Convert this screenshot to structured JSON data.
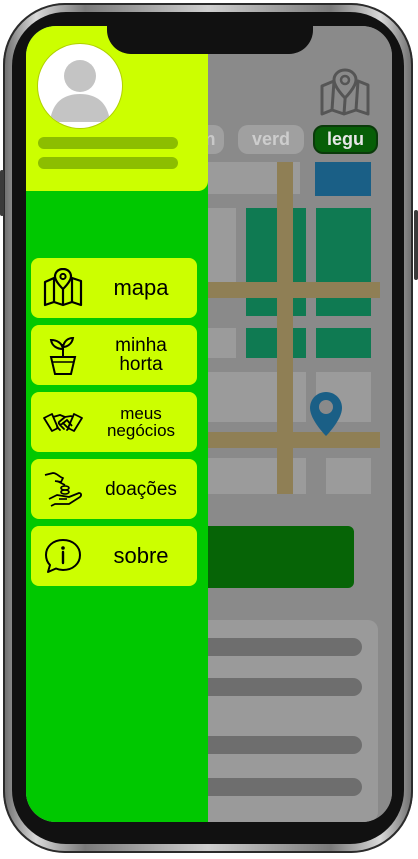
{
  "header": {
    "filter_chips": [
      "n",
      "verd",
      "legu"
    ]
  },
  "drawer": {
    "menu": [
      {
        "icon": "map-icon",
        "label_lines": [
          "mapa"
        ]
      },
      {
        "icon": "plant-pot-icon",
        "label_lines": [
          "minha",
          "horta"
        ]
      },
      {
        "icon": "handshake-icon",
        "label_lines": [
          "meus",
          "negócios"
        ]
      },
      {
        "icon": "donation-hand-icon",
        "label_lines": [
          "doações"
        ]
      },
      {
        "icon": "info-bubble-icon",
        "label_lines": [
          "sobre"
        ]
      }
    ]
  },
  "colors": {
    "drawer_bg": "#00c800",
    "menu_item_bg": "#ccff00",
    "active_chip": "#075e07",
    "map_green": "#0f7a52",
    "map_blue": "#1a5f86",
    "pin": "#1a5f86"
  }
}
